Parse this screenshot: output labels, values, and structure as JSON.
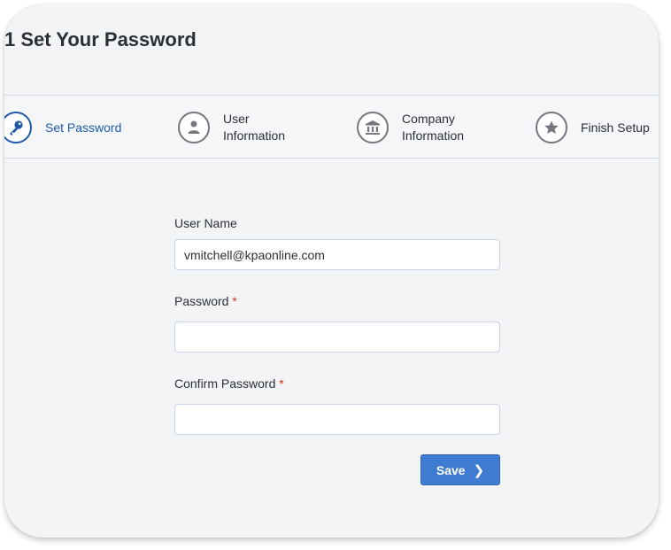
{
  "page": {
    "title": "1 Set Your Password",
    "accent_color": "#1f5aa8",
    "required_color": "#d93025"
  },
  "stepper": {
    "steps": [
      {
        "label_line1": "Set Password",
        "label_line2": "",
        "icon": "key-icon",
        "state": "active"
      },
      {
        "label_line1": "User",
        "label_line2": "Information",
        "icon": "user-icon",
        "state": "pending"
      },
      {
        "label_line1": "Company",
        "label_line2": "Information",
        "icon": "bank-icon",
        "state": "pending"
      },
      {
        "label_line1": "Finish Setup",
        "label_line2": "",
        "icon": "star-icon",
        "state": "pending"
      }
    ]
  },
  "form": {
    "username": {
      "label": "User Name",
      "value": "vmitchell@kpaonline.com"
    },
    "password": {
      "label": "Password",
      "required_mark": "*",
      "value": ""
    },
    "confirm_password": {
      "label": "Confirm Password",
      "required_mark": "*",
      "value": ""
    },
    "save_label": "Save",
    "save_icon": "chevron-right-icon"
  }
}
